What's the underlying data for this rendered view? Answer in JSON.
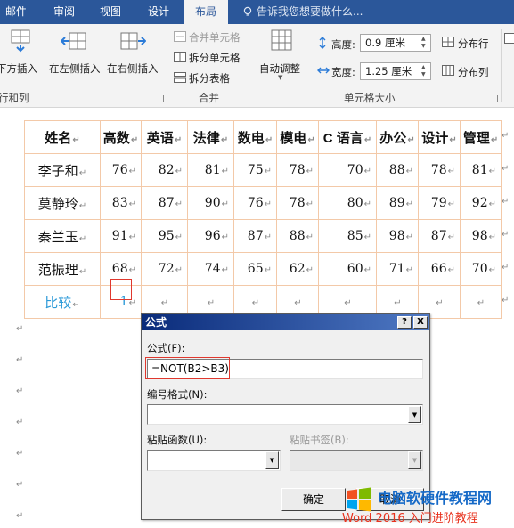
{
  "ribbon_tabs": [
    "邮件",
    "审阅",
    "视图",
    "设计",
    "布局"
  ],
  "active_tab": "布局",
  "tell_me_placeholder": "告诉我您想要做什么...",
  "rows_cols": {
    "insert_below": "下方插入",
    "insert_left": "在左侧插入",
    "insert_right": "在右侧插入",
    "group_label": "行和列"
  },
  "merge": {
    "merge_cells": "合并单元格",
    "split_cells": "拆分单元格",
    "split_table": "拆分表格",
    "group_label": "合并"
  },
  "cell_size": {
    "autofit": "自动调整",
    "height_label": "高度:",
    "height_value": "0.9 厘米",
    "width_label": "宽度:",
    "width_value": "1.25 厘米",
    "distribute_rows": "分布行",
    "distribute_cols": "分布列",
    "group_label": "单元格大小"
  },
  "table": {
    "headers": [
      "姓名",
      "高数",
      "英语",
      "法律",
      "数电",
      "模电",
      "C 语言",
      "办公",
      "设计",
      "管理"
    ],
    "rows": [
      [
        "李子和",
        "76",
        "82",
        "81",
        "75",
        "78",
        "70",
        "88",
        "78",
        "81"
      ],
      [
        "莫静玲",
        "83",
        "87",
        "90",
        "76",
        "78",
        "80",
        "89",
        "79",
        "92"
      ],
      [
        "秦兰玉",
        "91",
        "95",
        "96",
        "87",
        "88",
        "85",
        "98",
        "87",
        "98"
      ],
      [
        "范振理",
        "68",
        "72",
        "74",
        "65",
        "62",
        "60",
        "71",
        "66",
        "70"
      ]
    ],
    "compare_label": "比较",
    "compare_result": "1"
  },
  "formula_dialog": {
    "title": "公式",
    "help_button": "?",
    "close_button": "X",
    "formula_label": "公式(F):",
    "formula_value": "=NOT(B2>B3)",
    "number_format_label": "编号格式(N):",
    "number_format_value": "",
    "paste_function_label": "粘贴函数(U):",
    "paste_function_value": "",
    "paste_bookmark_label": "粘贴书签(B):",
    "paste_bookmark_value": "",
    "ok_button": "确定",
    "cancel_button": "取消"
  },
  "watermark": {
    "site_name": "电脑软硬件教程网",
    "caption": "Word 2016 入门进阶教程"
  },
  "colors": {
    "ribbon_blue": "#2b579a",
    "compare_text": "#2c9ad8",
    "highlight_red": "#e0382e",
    "table_border": "#f3c9a8"
  }
}
